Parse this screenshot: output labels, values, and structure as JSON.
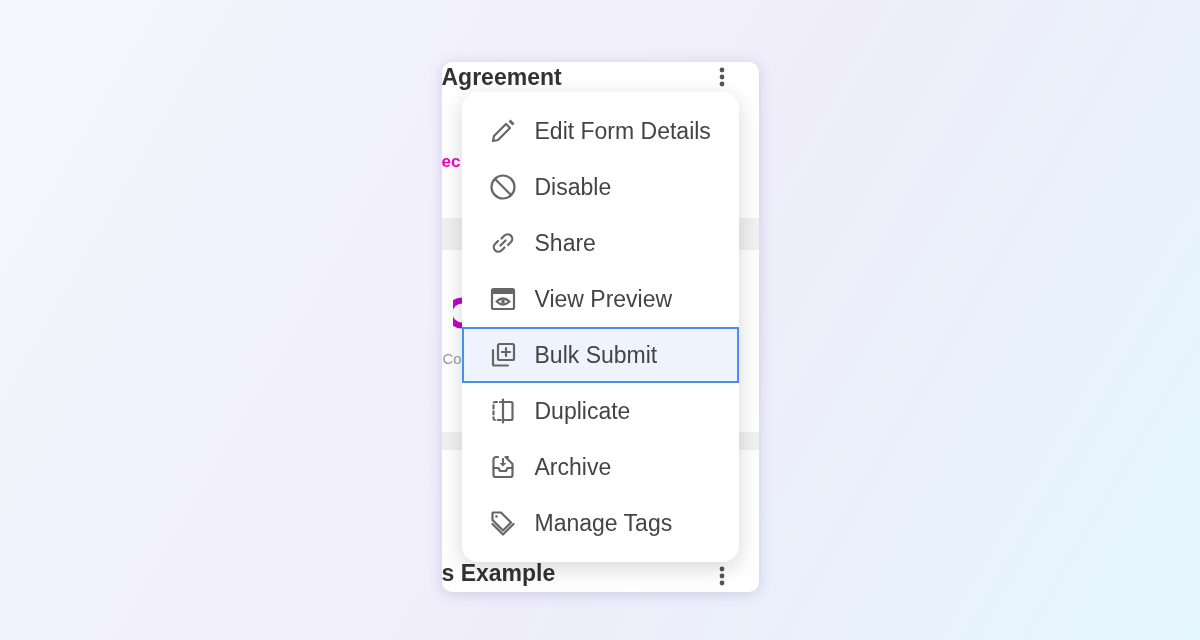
{
  "form_card": {
    "title": "Agreement",
    "status_text": "ec",
    "caption": "Co",
    "next_title": "s Example"
  },
  "menu": {
    "items": [
      {
        "label": "Edit Form Details",
        "selected": false
      },
      {
        "label": "Disable",
        "selected": false
      },
      {
        "label": "Share",
        "selected": false
      },
      {
        "label": "View Preview",
        "selected": false
      },
      {
        "label": "Bulk Submit",
        "selected": true
      },
      {
        "label": "Duplicate",
        "selected": false
      },
      {
        "label": "Archive",
        "selected": false
      },
      {
        "label": "Manage Tags",
        "selected": false
      }
    ]
  }
}
